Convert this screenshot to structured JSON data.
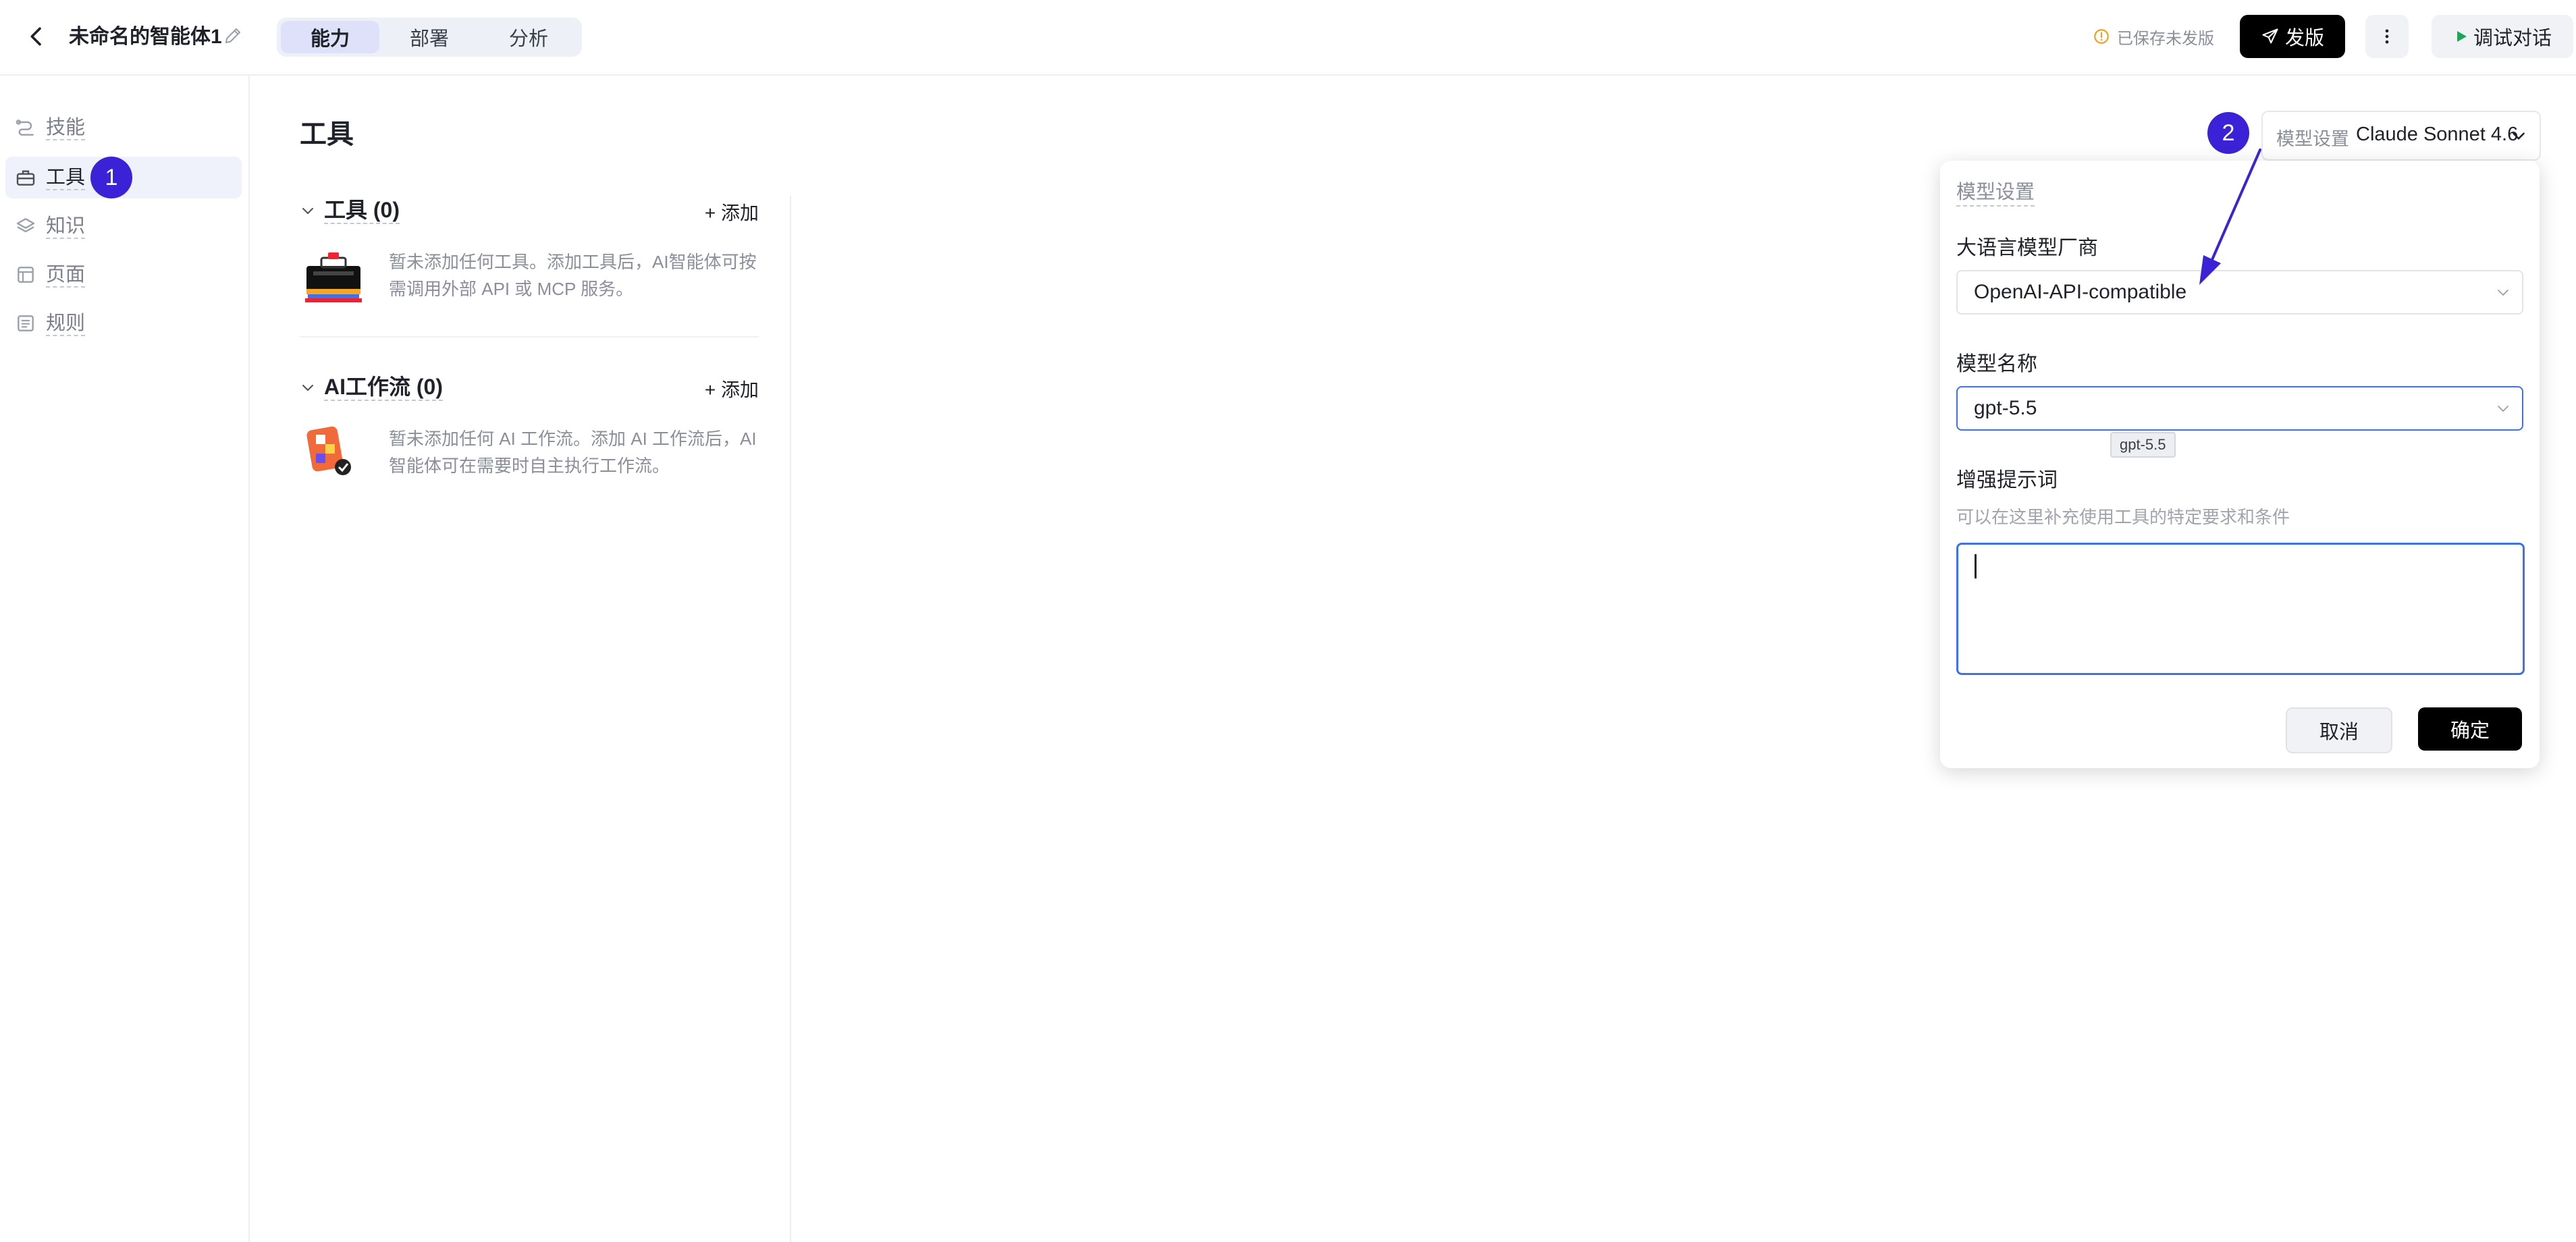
{
  "header": {
    "title": "未命名的智能体1",
    "tabs": [
      {
        "label": "能力",
        "active": true
      },
      {
        "label": "部署",
        "active": false
      },
      {
        "label": "分析",
        "active": false
      }
    ],
    "save_status": "已保存未发版",
    "publish_label": "发版",
    "debug_label": "调试对话"
  },
  "sidebar": {
    "items": [
      {
        "label": "技能",
        "icon": "skill-icon",
        "active": false
      },
      {
        "label": "工具",
        "icon": "toolbox-icon",
        "active": true
      },
      {
        "label": "知识",
        "icon": "layers-icon",
        "active": false
      },
      {
        "label": "页面",
        "icon": "page-icon",
        "active": false
      },
      {
        "label": "规则",
        "icon": "rules-icon",
        "active": false
      }
    ]
  },
  "annotations": {
    "badge1": "1",
    "badge2": "2"
  },
  "main": {
    "title": "工具",
    "sections": [
      {
        "name": "工具 (0)",
        "add_label": "+ 添加",
        "empty_text": "暂未添加任何工具。添加工具后，AI智能体可按需调用外部 API 或 MCP 服务。"
      },
      {
        "name": "AI工作流 (0)",
        "add_label": "+ 添加",
        "empty_text": "暂未添加任何 AI 工作流。添加 AI 工作流后，AI智能体可在需要时自主执行工作流。"
      }
    ]
  },
  "model_trigger": {
    "label": "模型设置",
    "value": "Claude Sonnet 4.6"
  },
  "popover": {
    "title": "模型设置",
    "vendor_label": "大语言模型厂商",
    "vendor_value": "OpenAI-API-compatible",
    "model_label": "模型名称",
    "model_value": "gpt-5.5",
    "model_tooltip": "gpt-5.5",
    "prompt_label": "增强提示词",
    "prompt_hint": "可以在这里补充使用工具的特定要求和条件",
    "prompt_value": "",
    "cancel_label": "取消",
    "ok_label": "确定"
  },
  "colors": {
    "accent": "#3b22d6",
    "focus": "#3d73e6",
    "publish": "#000000"
  }
}
